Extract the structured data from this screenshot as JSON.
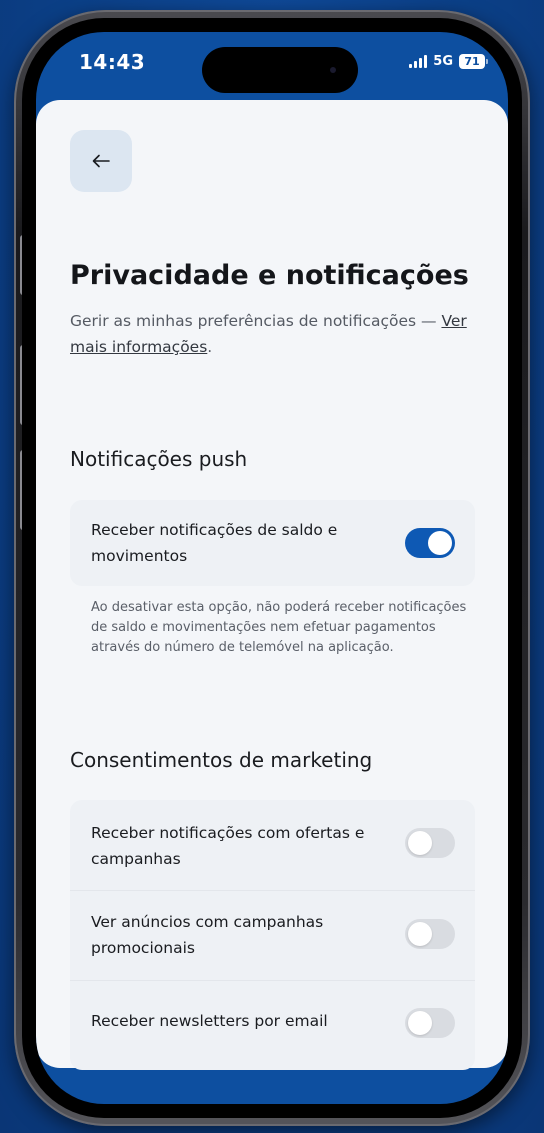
{
  "status_bar": {
    "time": "14:43",
    "network": "5G",
    "battery": "71"
  },
  "header": {
    "back_icon": "arrow-left-icon"
  },
  "page": {
    "title": "Privacidade e notificações",
    "subtitle_text": "Gerir as minhas preferências de notificações — ",
    "subtitle_link": "Ver mais informações",
    "subtitle_end": "."
  },
  "push_section": {
    "heading": "Notificações push",
    "items": [
      {
        "label": "Receber notificações de saldo e movimentos",
        "enabled": true
      }
    ],
    "helper_text": "Ao desativar esta opção, não poderá receber notificações de saldo e movimentações nem efetuar pagamentos através do número de telemóvel na aplicação."
  },
  "marketing_section": {
    "heading": "Consentimentos de marketing",
    "items": [
      {
        "label": "Receber notificações com ofertas e campanhas",
        "enabled": false
      },
      {
        "label": "Ver anúncios com campanhas promocionais",
        "enabled": false
      },
      {
        "label": "Receber newsletters por email",
        "enabled": false
      }
    ]
  },
  "colors": {
    "background": "#0b3f86",
    "accent": "#0e59b4",
    "toggle_off": "#d9dce1",
    "card": "#f4f6f9"
  }
}
